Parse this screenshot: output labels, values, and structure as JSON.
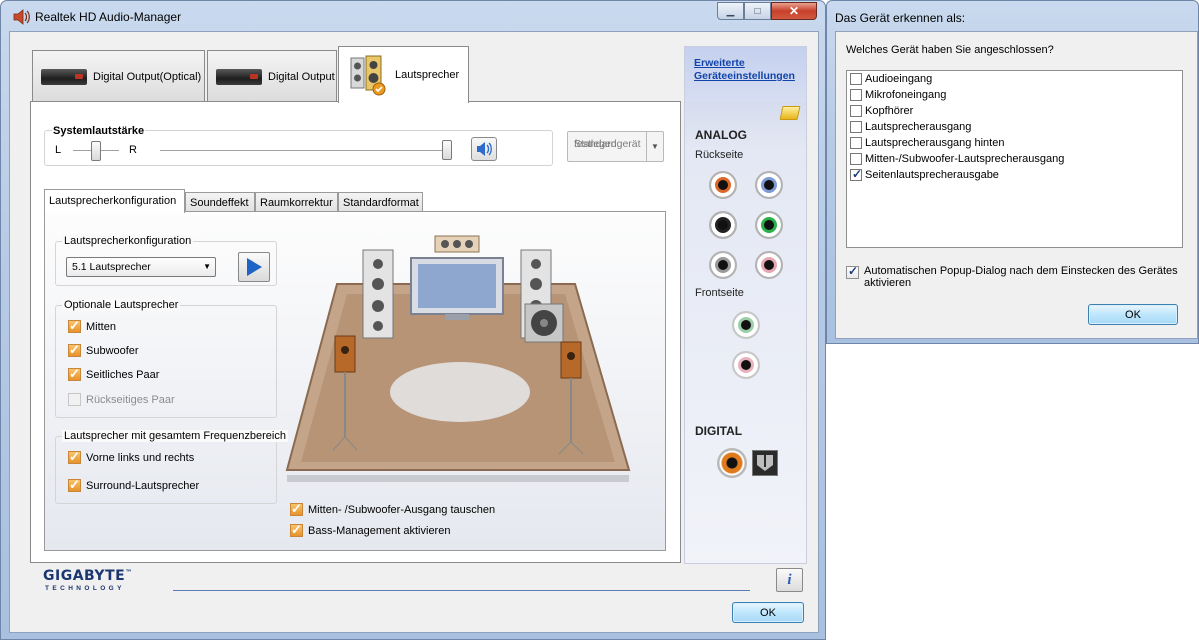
{
  "main_window": {
    "title": "Realtek HD Audio-Manager",
    "controls": {
      "minimize": "▁",
      "maximize": "□",
      "close": "✕"
    },
    "top_tabs": [
      {
        "label": "Digital Output(Optical)",
        "active": false
      },
      {
        "label": "Digital Output",
        "active": false
      },
      {
        "label": "Lautsprecher",
        "active": true
      }
    ],
    "volume": {
      "label": "Systemlautstärke",
      "left_label": "L",
      "right_label": "R",
      "balance": 0.5,
      "level": 1.0
    },
    "default_device_button": {
      "line1": "Standardgerät",
      "line2": "festlegen"
    },
    "inner_tabs": [
      {
        "label": "Lautsprecherkonfiguration",
        "active": true
      },
      {
        "label": "Soundeffekt",
        "active": false
      },
      {
        "label": "Raumkorrektur",
        "active": false
      },
      {
        "label": "Standardformat",
        "active": false
      }
    ],
    "speaker_config": {
      "group_title": "Lautsprecherkonfiguration",
      "selected": "5.1 Lautsprecher"
    },
    "optional_speakers": {
      "group_title": "Optionale Lautsprecher",
      "items": [
        {
          "label": "Mitten",
          "checked": true,
          "enabled": true
        },
        {
          "label": "Subwoofer",
          "checked": true,
          "enabled": true
        },
        {
          "label": "Seitliches Paar",
          "checked": true,
          "enabled": true
        },
        {
          "label": "Rückseitiges Paar",
          "checked": false,
          "enabled": false
        }
      ]
    },
    "full_range": {
      "group_title": "Lautsprecher mit gesamtem Frequenzbereich",
      "items": [
        {
          "label": "Vorne links und rechts",
          "checked": true
        },
        {
          "label": "Surround-Lautsprecher",
          "checked": true
        }
      ]
    },
    "bottom_options": [
      {
        "label": "Mitten- /Subwoofer-Ausgang tauschen",
        "checked": true
      },
      {
        "label": "Bass-Management aktivieren",
        "checked": true
      }
    ],
    "side_panel": {
      "link_line1": "Erweiterte",
      "link_line2": "Geräteeinstellungen",
      "analog_label": "ANALOG",
      "back_label": "Rückseite",
      "front_label": "Frontseite",
      "digital_label": "DIGITAL",
      "back_jacks": [
        {
          "name": "orange",
          "color": "#d8682b"
        },
        {
          "name": "blue",
          "color": "#7e9ad6"
        },
        {
          "name": "black",
          "color": "#222222"
        },
        {
          "name": "green",
          "color": "#2bb04a"
        },
        {
          "name": "gray",
          "color": "#9a9a9a"
        },
        {
          "name": "pink",
          "color": "#e8a6b4"
        }
      ],
      "front_jacks": [
        {
          "name": "green",
          "color": "#9ccfa9"
        },
        {
          "name": "pink",
          "color": "#e6b3bd"
        }
      ]
    },
    "brand": {
      "name": "GIGABYTE",
      "tm": "™",
      "sub": "TECHNOLOGY"
    },
    "info_label": "i",
    "ok_label": "OK"
  },
  "detect_dialog": {
    "title": "Das Gerät erkennen als:",
    "question": "Welches Gerät haben Sie angeschlossen?",
    "devices": [
      {
        "label": "Audioeingang",
        "checked": false
      },
      {
        "label": "Mikrofoneingang",
        "checked": false
      },
      {
        "label": "Kopfhörer",
        "checked": false
      },
      {
        "label": "Lautsprecherausgang",
        "checked": false
      },
      {
        "label": "Lautsprecherausgang hinten",
        "checked": false
      },
      {
        "label": "Mitten-/Subwoofer-Lautsprecherausgang",
        "checked": false
      },
      {
        "label": "Seitenlautsprecherausgabe",
        "checked": true
      }
    ],
    "auto_popup": {
      "line1": "Automatischen Popup-Dialog nach dem Einstecken des Gerätes",
      "line2": "aktivieren",
      "checked": true
    },
    "ok_label": "OK"
  }
}
